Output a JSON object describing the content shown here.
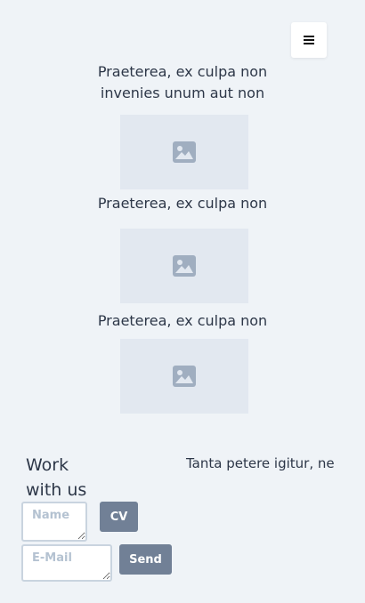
{
  "header": {
    "menu_icon": "hamburger-menu-icon"
  },
  "features": [
    {
      "caption_line1": "Praeterea, ex culpa non",
      "caption_line2": "invenies unum aut non",
      "image_icon": "image-placeholder-icon"
    },
    {
      "caption_line1": "Praeterea, ex culpa non",
      "image_icon": "image-placeholder-icon"
    },
    {
      "caption_line1": "Praeterea, ex culpa non",
      "image_icon": "image-placeholder-icon"
    }
  ],
  "work": {
    "title_line1": "Work",
    "title_line2": "with us",
    "side_text": "Tanta petere igitur, ne",
    "name_placeholder": "Name",
    "email_placeholder": "E-Mail",
    "cv_label": "CV",
    "send_label": "Send"
  },
  "colors": {
    "background": "#eff3f7",
    "placeholder_block": "#e2e8f0",
    "icon": "#a0aec0",
    "button": "#718096",
    "text": "#2d3748"
  }
}
